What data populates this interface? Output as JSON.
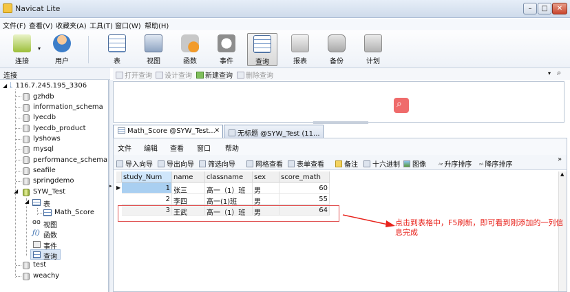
{
  "window": {
    "title": "Navicat Lite",
    "min": "–",
    "max": "□",
    "close": "✕"
  },
  "menubar": [
    "文件(F)",
    "查看(V)",
    "收藏夹(A)",
    "工具(T)",
    "窗口(W)",
    "帮助(H)"
  ],
  "toolbar": [
    {
      "label": "连接",
      "icon": "connect-icon"
    },
    {
      "label": "用户",
      "icon": "user-icon"
    },
    {
      "label": "表",
      "icon": "table-icon"
    },
    {
      "label": "视图",
      "icon": "view-icon"
    },
    {
      "label": "函数",
      "icon": "function-icon"
    },
    {
      "label": "事件",
      "icon": "event-icon"
    },
    {
      "label": "查询",
      "icon": "query-icon",
      "active": true
    },
    {
      "label": "报表",
      "icon": "report-icon"
    },
    {
      "label": "备份",
      "icon": "backup-icon"
    },
    {
      "label": "计划",
      "icon": "schedule-icon"
    }
  ],
  "left_header": "连接",
  "subbar": {
    "open_query": "打开查询",
    "design_query": "设计查询",
    "new_query": "新建查询",
    "delete_query": "删除查询"
  },
  "tree": {
    "connection": "116.7.245.195_3306",
    "databases": [
      "gzhdb",
      "information_schema",
      "lyecdb",
      "lyecdb_product",
      "lyshows",
      "mysql",
      "performance_schema",
      "seafile",
      "springdemo",
      "SYW_Test"
    ],
    "syw_children": {
      "tables_label": "表",
      "table": "Math_Score",
      "views": "视图",
      "functions": "函数",
      "events": "事件",
      "queries": "查询"
    },
    "after": [
      "test",
      "weachy"
    ]
  },
  "tabs": [
    {
      "label": "Math_Score @SYW_Test...",
      "close": "✕"
    },
    {
      "label": "无标题 @SYW_Test (11..."
    }
  ],
  "inner_menu": [
    "文件",
    "编辑",
    "查看",
    "窗口",
    "帮助"
  ],
  "inner_tools": [
    "导入向导",
    "导出向导",
    "筛选向导",
    "网格查看",
    "表单查看",
    "备注",
    "十六进制",
    "图像",
    "升序排序",
    "降序排序"
  ],
  "grid": {
    "columns": [
      "study_Num",
      "name",
      "classname",
      "sex",
      "score_math"
    ],
    "rows": [
      [
        "1",
        "张三",
        "高一（1）班",
        "男",
        "60"
      ],
      [
        "2",
        "李四",
        "高一(1)班",
        "男",
        "55"
      ],
      [
        "3",
        "王武",
        "高一（1）班",
        "男",
        "64"
      ]
    ]
  },
  "annotation": "点击到表格中，F5刷新，即可看到刚添加的一列信息完成",
  "colors": {
    "accent": "#e05050",
    "annotation": "#e8231c",
    "search": "#ef6b6b"
  }
}
